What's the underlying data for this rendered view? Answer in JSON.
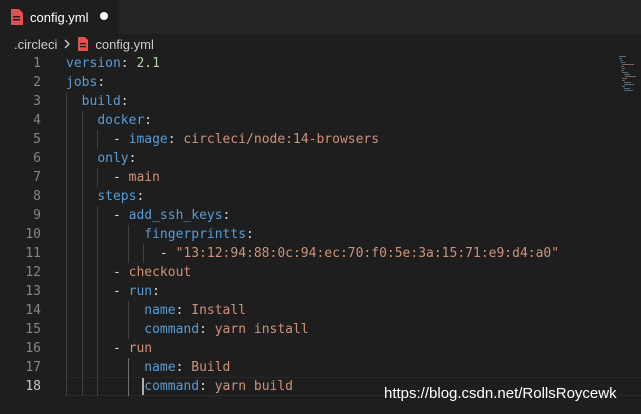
{
  "tab": {
    "label": "config.yml",
    "icon": "yaml-file-icon",
    "icon_color": "#e05252",
    "modified": true
  },
  "breadcrumb": {
    "folder": ".circleci",
    "file": "config.yml"
  },
  "colors": {
    "key": "#569cd6",
    "string": "#ce9178",
    "number": "#b5cea8",
    "text": "#d4d4d4",
    "background": "#1e1e1e"
  },
  "editor": {
    "active_line": 18,
    "lines": [
      {
        "num": "1",
        "tokens": [
          [
            "k",
            "version"
          ],
          [
            "p",
            ": "
          ],
          [
            "n",
            "2.1"
          ]
        ]
      },
      {
        "num": "2",
        "tokens": [
          [
            "k",
            "jobs"
          ],
          [
            "p",
            ":"
          ]
        ]
      },
      {
        "num": "3",
        "tokens": [
          [
            "p",
            "  "
          ],
          [
            "k",
            "build"
          ],
          [
            "p",
            ":"
          ]
        ]
      },
      {
        "num": "4",
        "tokens": [
          [
            "p",
            "    "
          ],
          [
            "k",
            "docker"
          ],
          [
            "p",
            ":"
          ]
        ]
      },
      {
        "num": "5",
        "tokens": [
          [
            "p",
            "      - "
          ],
          [
            "k",
            "image"
          ],
          [
            "p",
            ": "
          ],
          [
            "s",
            "circleci/node:14-browsers"
          ]
        ]
      },
      {
        "num": "6",
        "tokens": [
          [
            "p",
            "    "
          ],
          [
            "k",
            "only"
          ],
          [
            "p",
            ":"
          ]
        ]
      },
      {
        "num": "7",
        "tokens": [
          [
            "p",
            "      - "
          ],
          [
            "s",
            "main"
          ]
        ]
      },
      {
        "num": "8",
        "tokens": [
          [
            "p",
            "    "
          ],
          [
            "k",
            "steps"
          ],
          [
            "p",
            ":"
          ]
        ]
      },
      {
        "num": "9",
        "tokens": [
          [
            "p",
            "      - "
          ],
          [
            "k",
            "add_ssh_keys"
          ],
          [
            "p",
            ":"
          ]
        ]
      },
      {
        "num": "10",
        "tokens": [
          [
            "p",
            "          "
          ],
          [
            "k",
            "fingerprintts"
          ],
          [
            "p",
            ":"
          ]
        ]
      },
      {
        "num": "11",
        "tokens": [
          [
            "p",
            "            - "
          ],
          [
            "s",
            "\"13:12:94:88:0c:94:ec:70:f0:5e:3a:15:71:e9:d4:a0\""
          ]
        ]
      },
      {
        "num": "12",
        "tokens": [
          [
            "p",
            "      - "
          ],
          [
            "s",
            "checkout"
          ]
        ]
      },
      {
        "num": "13",
        "tokens": [
          [
            "p",
            "      - "
          ],
          [
            "k",
            "run"
          ],
          [
            "p",
            ":"
          ]
        ]
      },
      {
        "num": "14",
        "tokens": [
          [
            "p",
            "          "
          ],
          [
            "k",
            "name"
          ],
          [
            "p",
            ": "
          ],
          [
            "s",
            "Install"
          ]
        ]
      },
      {
        "num": "15",
        "tokens": [
          [
            "p",
            "          "
          ],
          [
            "k",
            "command"
          ],
          [
            "p",
            ": "
          ],
          [
            "s",
            "yarn install"
          ]
        ]
      },
      {
        "num": "16",
        "tokens": [
          [
            "p",
            "      - "
          ],
          [
            "s",
            "run"
          ]
        ]
      },
      {
        "num": "17",
        "tokens": [
          [
            "p",
            "          "
          ],
          [
            "k",
            "name"
          ],
          [
            "p",
            ": "
          ],
          [
            "s",
            "Build"
          ]
        ]
      },
      {
        "num": "18",
        "tokens": [
          [
            "p",
            "          "
          ],
          [
            "k",
            "command"
          ],
          [
            "p",
            ": "
          ],
          [
            "s",
            "yarn build"
          ]
        ]
      }
    ]
  },
  "watermark": "https://blog.csdn.net/RollsRoycewk"
}
